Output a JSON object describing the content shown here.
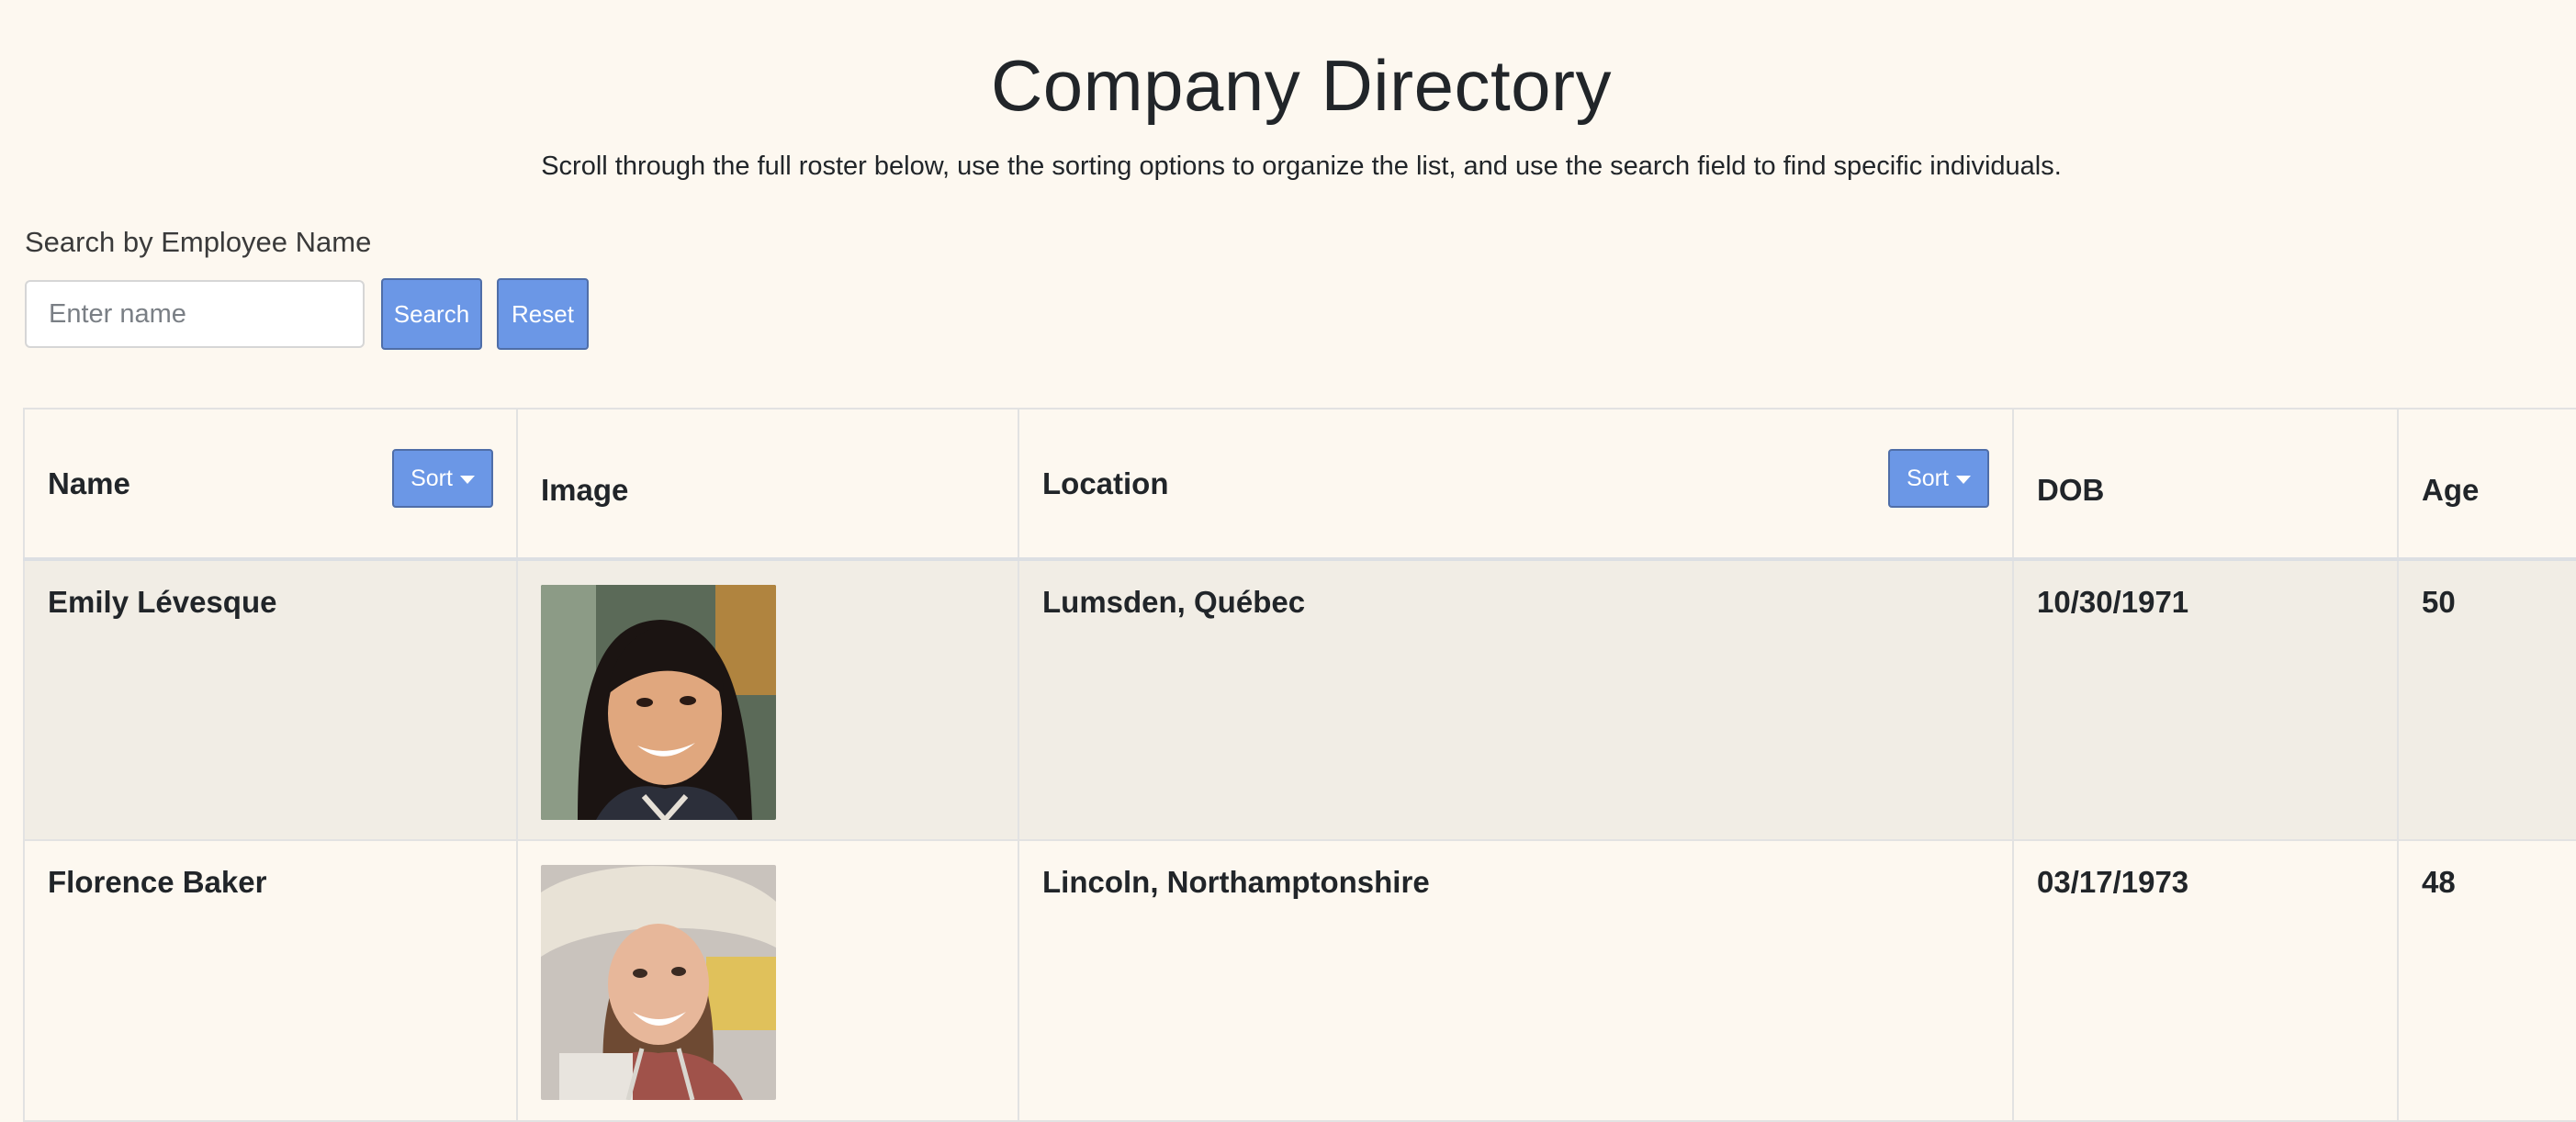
{
  "page": {
    "title": "Company Directory",
    "subtitle": "Scroll through the full roster below, use the sorting options to organize the list, and use the search field to find specific individuals."
  },
  "search": {
    "label": "Search by Employee Name",
    "placeholder": "Enter name",
    "value": "",
    "search_button": "Search",
    "reset_button": "Reset"
  },
  "table": {
    "headers": {
      "name": "Name",
      "image": "Image",
      "location": "Location",
      "dob": "DOB",
      "age": "Age"
    },
    "sort_label": "Sort",
    "rows": [
      {
        "name": "Emily Lévesque",
        "location": "Lumsden, Québec",
        "dob": "10/30/1971",
        "age": "50",
        "photo": "portrait-woman-dark-hair-smiling"
      },
      {
        "name": "Florence Baker",
        "location": "Lincoln, Northamptonshire",
        "dob": "03/17/1973",
        "age": "48",
        "photo": "portrait-woman-sun-hat-smiling"
      }
    ]
  },
  "colors": {
    "background": "#fdf8f0",
    "button": "#6b97e6",
    "button_border": "#4f6ea8",
    "shaded_row": "#f1ede5"
  }
}
